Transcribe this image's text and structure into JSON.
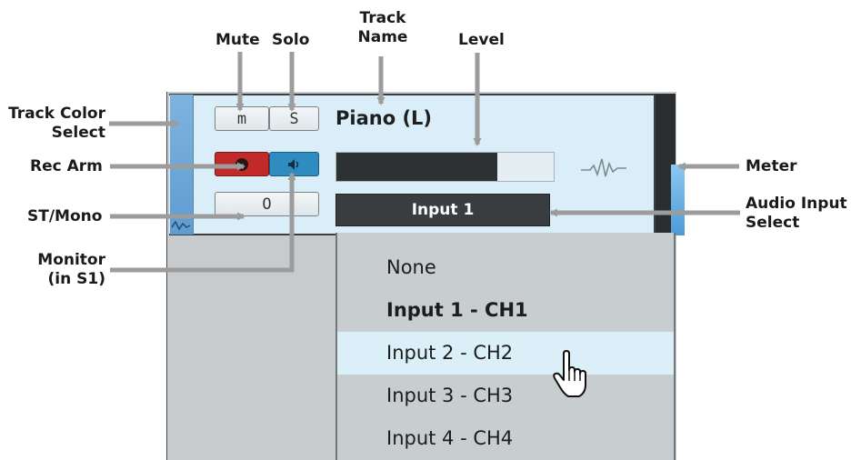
{
  "callouts": {
    "mute": "Mute",
    "solo": "Solo",
    "track_name_line1": "Track",
    "track_name_line2": "Name",
    "level": "Level",
    "track_color_line1": "Track Color",
    "track_color_line2": "Select",
    "rec_arm": "Rec Arm",
    "st_mono": "ST/Mono",
    "monitor_line1": "Monitor",
    "monitor_line2": "(in S1)",
    "meter": "Meter",
    "audio_input_line1": "Audio Input",
    "audio_input_line2": "Select"
  },
  "track": {
    "name": "Piano (L)",
    "mute_label": "m",
    "solo_label": "S",
    "stmono_label": "O",
    "monitor_icon": "speaker-icon",
    "record_icon": "record-dot-icon",
    "waveform_icon": "waveform-icon",
    "level_fraction": 0.74,
    "input_value": "Input 1",
    "color": "#6ea8d8",
    "meter_color": "#4c9ad8"
  },
  "dropdown": {
    "items": [
      {
        "label": "None"
      },
      {
        "label": "Input 1 - CH1"
      },
      {
        "label": "Input 2 - CH2"
      },
      {
        "label": "Input 3 - CH3"
      },
      {
        "label": "Input 4 - CH4"
      }
    ],
    "selected_index": 1,
    "hovered_index": 2,
    "cursor_icon": "hand-pointer-icon"
  }
}
